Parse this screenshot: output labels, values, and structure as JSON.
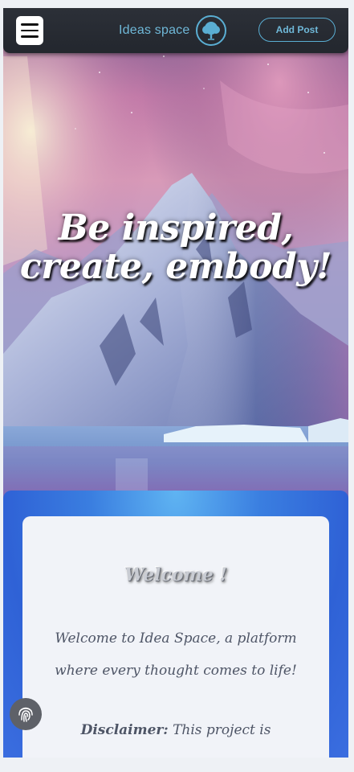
{
  "header": {
    "menu_icon": "hamburger-menu-icon",
    "brand_name": "Ideas space",
    "brand_logo_icon": "tree-icon",
    "add_post_label": "Add Post"
  },
  "hero": {
    "title_line1": "Be inspired,",
    "title_line2": "create, embody!",
    "background": "aurora-mountain-iceberg"
  },
  "welcome": {
    "title": "Welcome !",
    "text": "Welcome to Idea Space, a platform where every thought comes to life!",
    "disclaimer_label": "Disclaimer:",
    "disclaimer_text": " This project is"
  },
  "floating": {
    "fingerprint_icon": "fingerprint-icon"
  },
  "colors": {
    "accent": "#6fb8d8",
    "header_bg": "#2c3038",
    "section_blue": "#3a7ee0",
    "card_bg": "#f1f3f8",
    "text_muted": "#4e5566"
  }
}
